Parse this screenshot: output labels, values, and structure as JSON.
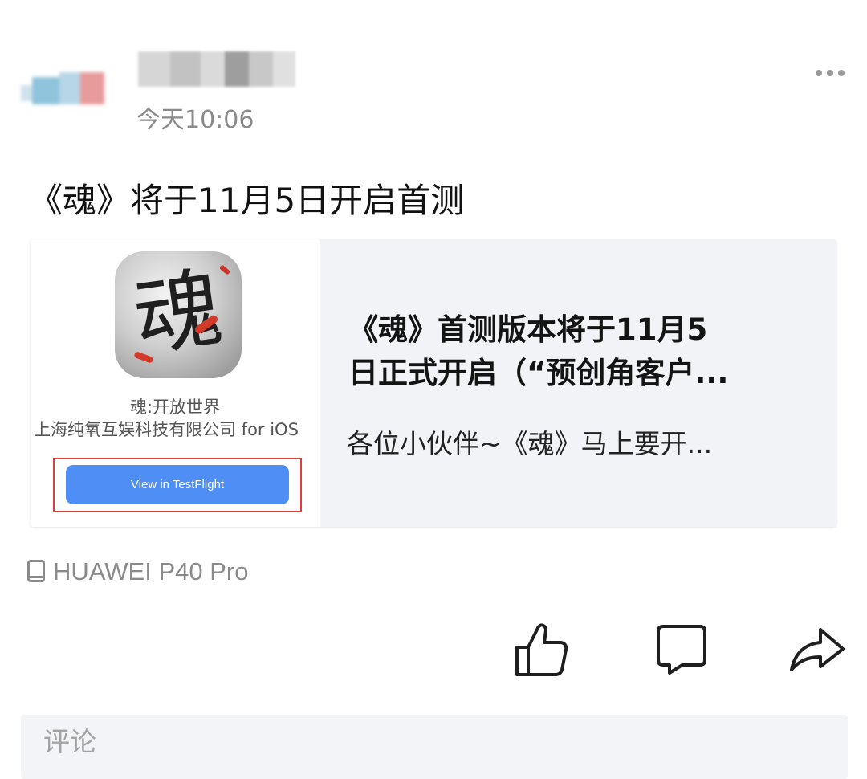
{
  "post": {
    "time": "今天10:06",
    "title": "《魂》将于11月5日开启首测",
    "device": "HUAWEI P40 Pro"
  },
  "card": {
    "thumbnail": {
      "icon_char": "魂",
      "app_name": "魂:开放世界",
      "publisher": "上海纯氧互娱科技有限公司 for iOS",
      "button_label": "View in TestFlight"
    },
    "title": "《魂》首测版本将于11月5\n日正式开启（“预创角客户...",
    "description": "各位小伙伴~《魂》马上要开..."
  },
  "actions": {
    "like": "thumb-up-icon",
    "comment": "comment-icon",
    "share": "share-icon"
  },
  "comment_input": {
    "placeholder": "评论"
  },
  "colors": {
    "accent_button": "#4f8ef5",
    "highlight_border": "#d9413a",
    "muted_text": "#8a8a8a",
    "card_bg": "#f2f3f7"
  }
}
